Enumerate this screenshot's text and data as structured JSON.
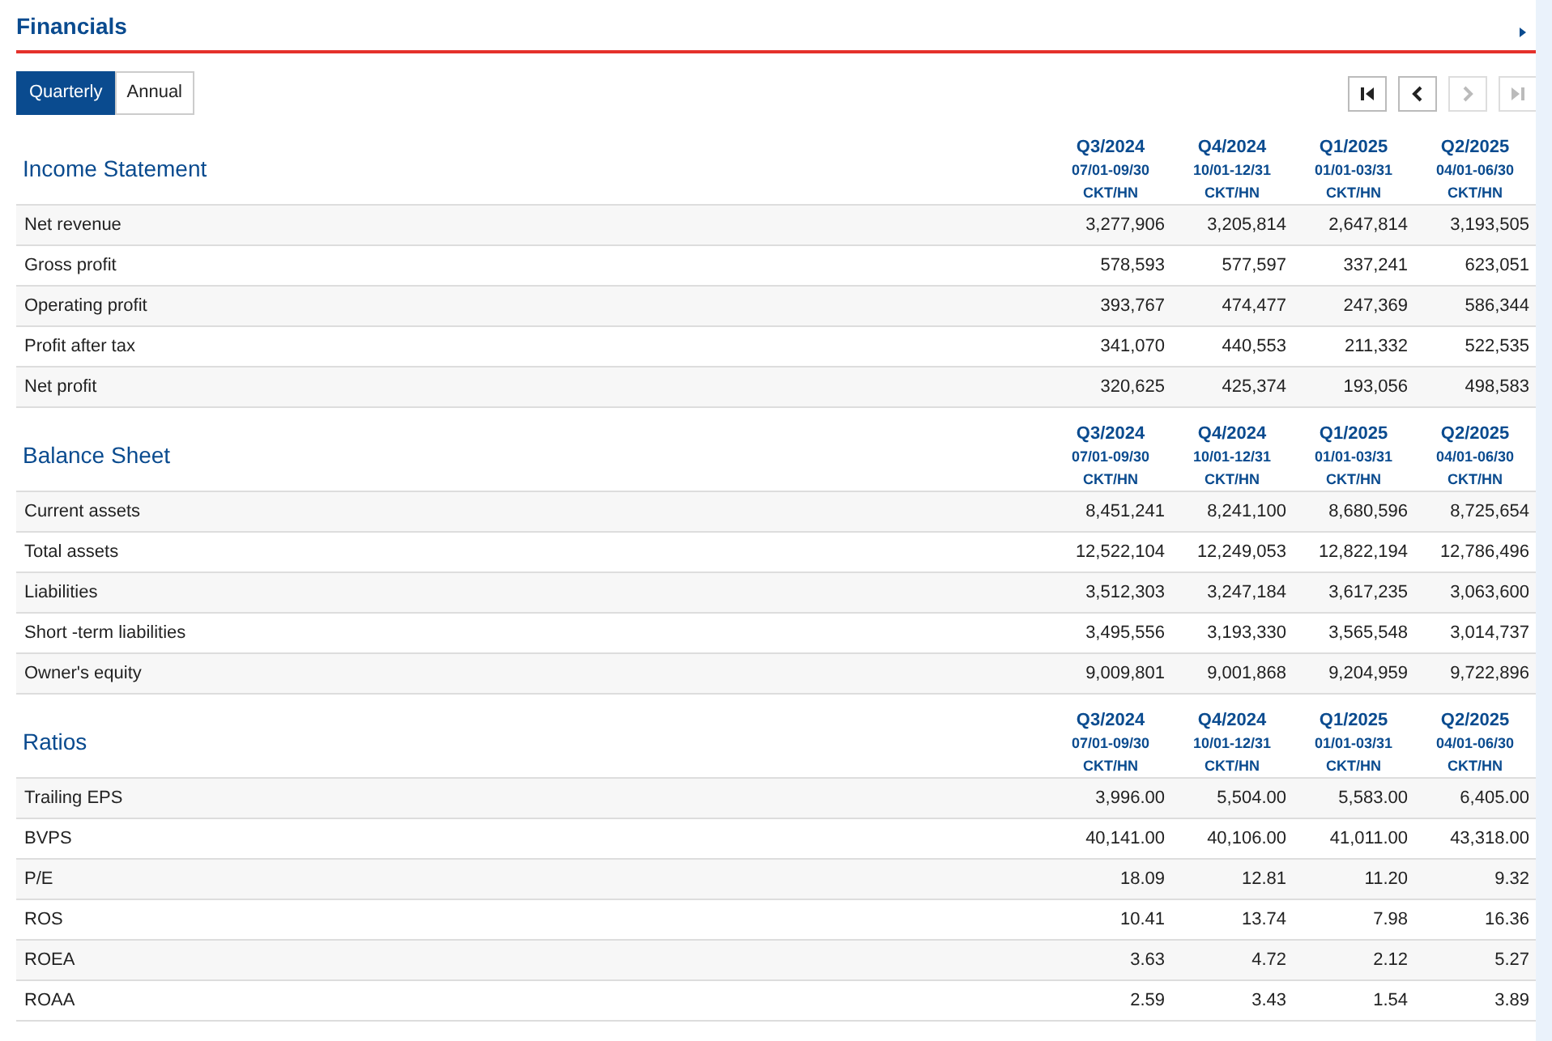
{
  "title": "Financials",
  "tabs": [
    {
      "label": "Quarterly",
      "selected": true
    },
    {
      "label": "Annual",
      "selected": false
    }
  ],
  "pager": [
    {
      "kind": "first",
      "disabled": false
    },
    {
      "kind": "prev",
      "disabled": false
    },
    {
      "kind": "next",
      "disabled": true
    },
    {
      "kind": "last",
      "disabled": true
    }
  ],
  "sections": [
    {
      "title": "Income Statement",
      "columns": [
        {
          "period": "Q3/2024",
          "range": "07/01-09/30",
          "audit": "CKT/HN"
        },
        {
          "period": "Q4/2024",
          "range": "10/01-12/31",
          "audit": "CKT/HN"
        },
        {
          "period": "Q1/2025",
          "range": "01/01-03/31",
          "audit": "CKT/HN"
        },
        {
          "period": "Q2/2025",
          "range": "04/01-06/30",
          "audit": "CKT/HN"
        }
      ],
      "rows": [
        {
          "label": "Net revenue",
          "values": [
            "3,277,906",
            "3,205,814",
            "2,647,814",
            "3,193,505"
          ]
        },
        {
          "label": "Gross profit",
          "values": [
            "578,593",
            "577,597",
            "337,241",
            "623,051"
          ]
        },
        {
          "label": "Operating profit",
          "values": [
            "393,767",
            "474,477",
            "247,369",
            "586,344"
          ]
        },
        {
          "label": "Profit after tax",
          "values": [
            "341,070",
            "440,553",
            "211,332",
            "522,535"
          ]
        },
        {
          "label": "Net profit",
          "values": [
            "320,625",
            "425,374",
            "193,056",
            "498,583"
          ]
        }
      ]
    },
    {
      "title": "Balance Sheet",
      "columns": [
        {
          "period": "Q3/2024",
          "range": "07/01-09/30",
          "audit": "CKT/HN"
        },
        {
          "period": "Q4/2024",
          "range": "10/01-12/31",
          "audit": "CKT/HN"
        },
        {
          "period": "Q1/2025",
          "range": "01/01-03/31",
          "audit": "CKT/HN"
        },
        {
          "period": "Q2/2025",
          "range": "04/01-06/30",
          "audit": "CKT/HN"
        }
      ],
      "rows": [
        {
          "label": "Current assets",
          "values": [
            "8,451,241",
            "8,241,100",
            "8,680,596",
            "8,725,654"
          ]
        },
        {
          "label": "Total assets",
          "values": [
            "12,522,104",
            "12,249,053",
            "12,822,194",
            "12,786,496"
          ]
        },
        {
          "label": "Liabilities",
          "values": [
            "3,512,303",
            "3,247,184",
            "3,617,235",
            "3,063,600"
          ]
        },
        {
          "label": "Short -term liabilities",
          "values": [
            "3,495,556",
            "3,193,330",
            "3,565,548",
            "3,014,737"
          ]
        },
        {
          "label": "Owner's equity",
          "values": [
            "9,009,801",
            "9,001,868",
            "9,204,959",
            "9,722,896"
          ]
        }
      ]
    },
    {
      "title": "Ratios",
      "columns": [
        {
          "period": "Q3/2024",
          "range": "07/01-09/30",
          "audit": "CKT/HN"
        },
        {
          "period": "Q4/2024",
          "range": "10/01-12/31",
          "audit": "CKT/HN"
        },
        {
          "period": "Q1/2025",
          "range": "01/01-03/31",
          "audit": "CKT/HN"
        },
        {
          "period": "Q2/2025",
          "range": "04/01-06/30",
          "audit": "CKT/HN"
        }
      ],
      "rows": [
        {
          "label": "Trailing EPS",
          "values": [
            "3,996.00",
            "5,504.00",
            "5,583.00",
            "6,405.00"
          ]
        },
        {
          "label": "BVPS",
          "values": [
            "40,141.00",
            "40,106.00",
            "41,011.00",
            "43,318.00"
          ]
        },
        {
          "label": "P/E",
          "values": [
            "18.09",
            "12.81",
            "11.20",
            "9.32"
          ]
        },
        {
          "label": "ROS",
          "values": [
            "10.41",
            "13.74",
            "7.98",
            "16.36"
          ]
        },
        {
          "label": "ROEA",
          "values": [
            "3.63",
            "4.72",
            "2.12",
            "5.27"
          ]
        },
        {
          "label": "ROAA",
          "values": [
            "2.59",
            "3.43",
            "1.54",
            "3.89"
          ]
        }
      ]
    }
  ]
}
